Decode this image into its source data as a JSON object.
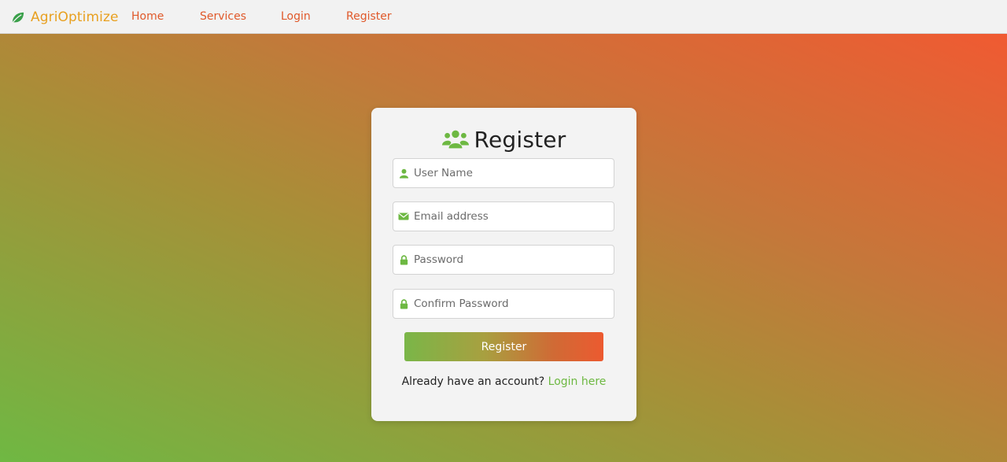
{
  "nav": {
    "brand": "AgriOptimize",
    "brand_icon": "leaf-icon",
    "links": [
      {
        "label": "Home"
      },
      {
        "label": "Services"
      },
      {
        "label": "Login"
      },
      {
        "label": "Register"
      }
    ]
  },
  "form": {
    "title": "Register",
    "title_icon": "users-icon",
    "fields": [
      {
        "placeholder": "User Name",
        "value": "",
        "icon": "user-icon"
      },
      {
        "placeholder": "Email address",
        "value": "",
        "icon": "envelope-icon"
      },
      {
        "placeholder": "Password",
        "value": "",
        "icon": "lock-icon"
      },
      {
        "placeholder": "Confirm Password",
        "value": "",
        "icon": "lock-icon"
      }
    ],
    "submit_label": "Register",
    "login_prompt": "Already have an account?",
    "login_link": "Login here"
  },
  "colors": {
    "brand": "#e8a020",
    "nav_link": "#e0592a",
    "accent_green": "#6db842",
    "gradient_start": "#6fb843",
    "gradient_end": "#f05a32"
  }
}
